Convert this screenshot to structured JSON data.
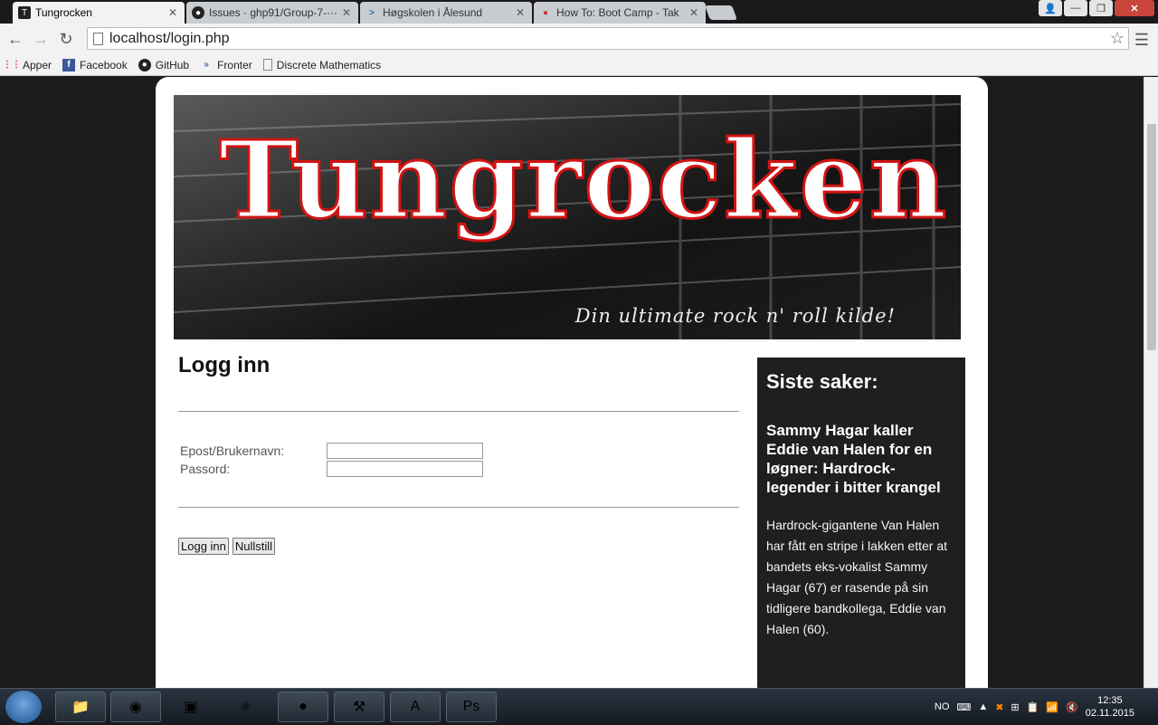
{
  "browser": {
    "tabs": [
      {
        "title": "Tungrocken",
        "active": true
      },
      {
        "title": "Issues · ghp91/Group-7-···",
        "active": false
      },
      {
        "title": "Høgskolen i Ålesund",
        "active": false
      },
      {
        "title": "How To: Boot Camp - Tak",
        "active": false
      }
    ],
    "address": "localhost/login.php",
    "bookmarks": [
      "Apper",
      "Facebook",
      "GitHub",
      "Fronter",
      "Discrete Mathematics"
    ]
  },
  "banner": {
    "logo": "Tungrocken",
    "tagline": "Din ultimate rock n' roll kilde!"
  },
  "login": {
    "heading": "Logg inn",
    "username_label": "Epost/Brukernavn:",
    "password_label": "Passord:",
    "submit_label": "Logg inn",
    "reset_label": "Nullstill"
  },
  "sidebar": {
    "heading": "Siste saker:",
    "article_title": "Sammy Hagar kaller Eddie van Halen for en løgner: Hardrock-legender i bitter krangel",
    "article_text": "Hardrock-gigantene Van Halen har fått en stripe i lakken etter at bandets eks-vokalist Sammy Hagar (67) er rasende på sin tidligere bandkollega, Eddie van Halen (60)."
  },
  "taskbar": {
    "language": "NO",
    "time": "12:35",
    "date": "02.11.2015"
  }
}
